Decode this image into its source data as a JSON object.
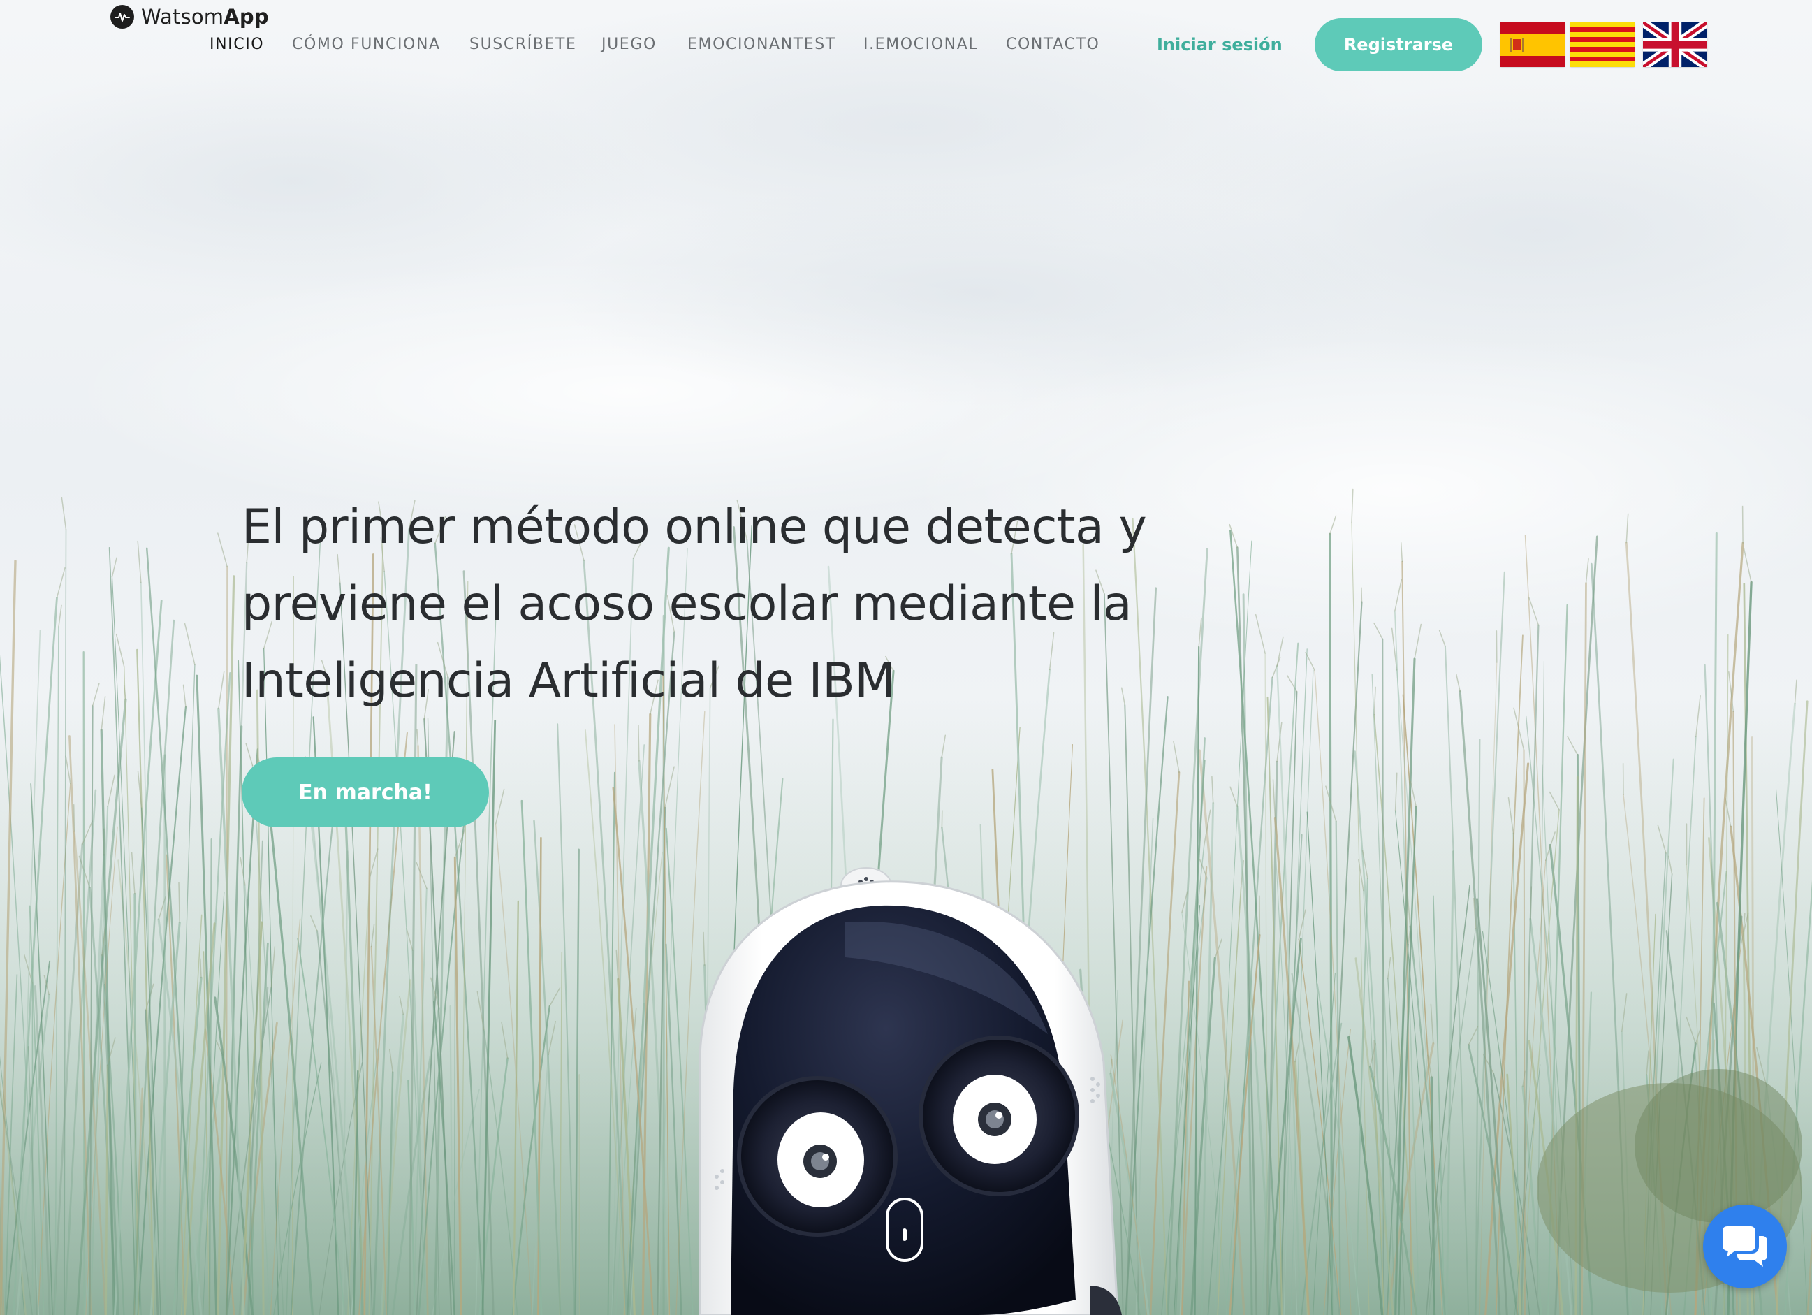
{
  "brand": {
    "name_regular": "Watsom",
    "name_bold": "App"
  },
  "nav": {
    "items": [
      {
        "label": "INICIO",
        "active": true
      },
      {
        "label": "CÓMO FUNCIONA",
        "active": false
      },
      {
        "label": "SUSCRÍBETE",
        "active": false
      },
      {
        "label": "JUEGO",
        "active": false
      },
      {
        "label": "EMOCIONANTEST",
        "active": false
      },
      {
        "label": "I.EMOCIONAL",
        "active": false
      },
      {
        "label": "CONTACTO",
        "active": false
      }
    ]
  },
  "auth": {
    "login_label": "Iniciar sesión",
    "register_label": "Registrarse"
  },
  "languages": [
    {
      "code": "es",
      "icon": "spain-flag-icon"
    },
    {
      "code": "ca",
      "icon": "catalonia-flag-icon"
    },
    {
      "code": "en",
      "icon": "uk-flag-icon"
    }
  ],
  "hero": {
    "headline_lines": [
      "El primer método online que detecta y",
      "previene el acoso escolar mediante la",
      "Inteligencia Artificial de IBM"
    ],
    "cta_label": "En marcha!"
  },
  "widgets": {
    "chat_icon": "chat-bubbles-icon",
    "scroll_icon": "mouse-scroll-icon"
  },
  "colors": {
    "accent": "#5ecab8",
    "accent_text": "#3fae9c",
    "chat": "#2f80ed",
    "nav_text": "#6b6f73",
    "nav_active": "#161616",
    "headline": "#2a2d30"
  }
}
